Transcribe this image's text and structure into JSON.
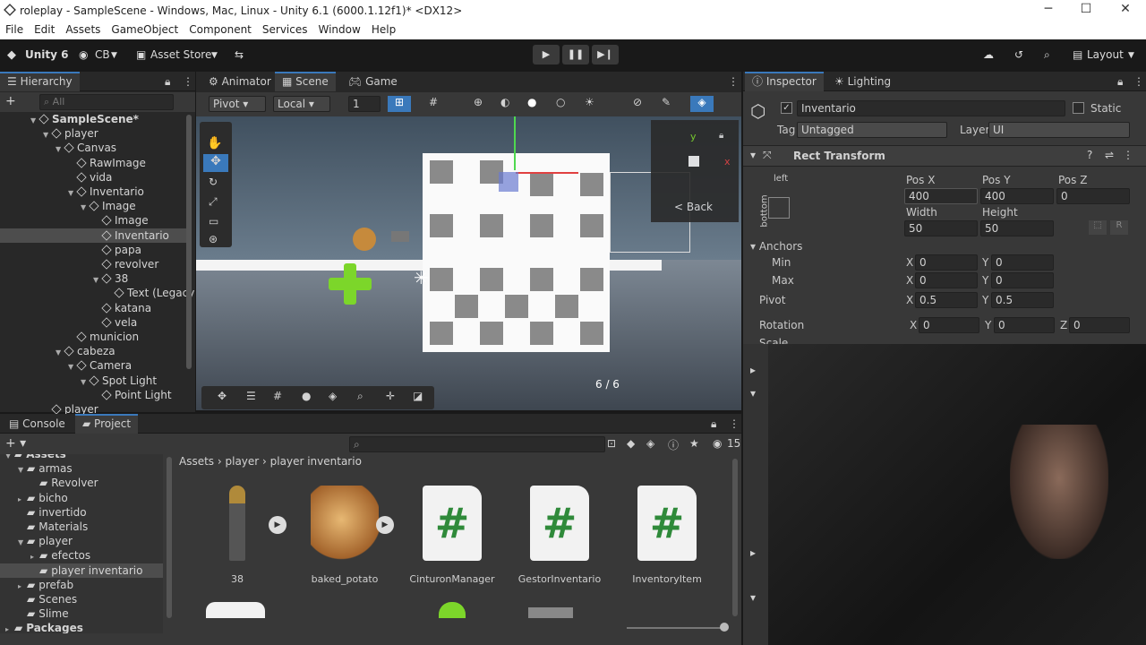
{
  "window": {
    "title": "roleplay - SampleScene - Windows, Mac, Linux - Unity 6.1 (6000.1.12f1)* <DX12>",
    "controls": [
      "─",
      "☐",
      "✕"
    ]
  },
  "menu": [
    "File",
    "Edit",
    "Assets",
    "GameObject",
    "Component",
    "Services",
    "Window",
    "Help"
  ],
  "toolbar": {
    "unity_label": "Unity 6",
    "account": "CB",
    "asset_store": "Asset Store",
    "layout": "Layout"
  },
  "hierarchy": {
    "tab": "Hierarchy",
    "search_placeholder": "All",
    "items": [
      {
        "label": "SampleScene*",
        "depth": 0,
        "bold": true
      },
      {
        "label": "player",
        "depth": 1
      },
      {
        "label": "Canvas",
        "depth": 2
      },
      {
        "label": "RawImage",
        "depth": 3
      },
      {
        "label": "vida",
        "depth": 3
      },
      {
        "label": "Inventario",
        "depth": 3
      },
      {
        "label": "Image",
        "depth": 4
      },
      {
        "label": "Image",
        "depth": 5
      },
      {
        "label": "Inventario",
        "depth": 5,
        "selected": true
      },
      {
        "label": "papa",
        "depth": 5
      },
      {
        "label": "revolver",
        "depth": 5
      },
      {
        "label": "38",
        "depth": 5
      },
      {
        "label": "Text (Legacy",
        "depth": 6
      },
      {
        "label": "katana",
        "depth": 5
      },
      {
        "label": "vela",
        "depth": 5
      },
      {
        "label": "municion",
        "depth": 3
      },
      {
        "label": "cabeza",
        "depth": 2
      },
      {
        "label": "Camera",
        "depth": 3
      },
      {
        "label": "Spot Light",
        "depth": 4
      },
      {
        "label": "Point Light",
        "depth": 5
      },
      {
        "label": "player",
        "depth": 1
      }
    ]
  },
  "scene_tabs": [
    "Animator",
    "Scene",
    "Game"
  ],
  "scene_toolbar": {
    "pivot": "Pivot",
    "local": "Local",
    "snap": "1"
  },
  "scene": {
    "back_label": "< Back",
    "counter": "6 / 6",
    "gizmo_y": "y",
    "gizmo_x": "x"
  },
  "inspector": {
    "tabs": [
      "Inspector",
      "Lighting"
    ],
    "object_name": "Inventario",
    "static_label": "Static",
    "tag_label": "Tag",
    "tag_value": "Untagged",
    "layer_label": "Layer",
    "layer_value": "UI",
    "component": "Rect Transform",
    "anchor_preset_top": "left",
    "anchor_preset_side": "bottom",
    "pos_labels": [
      "Pos X",
      "Pos Y",
      "Pos Z"
    ],
    "pos_values": [
      "400",
      "400",
      "0"
    ],
    "size_labels": [
      "Width",
      "Height"
    ],
    "size_values": [
      "50",
      "50"
    ],
    "r_button": "R",
    "anchors_label": "Anchors",
    "min_label": "Min",
    "min_values": [
      "0",
      "0"
    ],
    "max_label": "Max",
    "max_values": [
      "0",
      "0"
    ],
    "pivot_label": "Pivot",
    "pivot_values": [
      "0.5",
      "0.5"
    ],
    "rotation_label": "Rotation",
    "rotation_values": [
      "0",
      "0",
      "0"
    ],
    "scale_label": "Scale",
    "axis_x": "X",
    "axis_y": "Y",
    "axis_z": "Z"
  },
  "project": {
    "tabs": [
      "Console",
      "Project"
    ],
    "breadcrumb": [
      "Assets",
      "player",
      "player inventario"
    ],
    "count": "15",
    "folders": [
      {
        "label": "Assets",
        "depth": 0
      },
      {
        "label": "armas",
        "depth": 1
      },
      {
        "label": "Revolver",
        "depth": 2
      },
      {
        "label": "bicho",
        "depth": 1
      },
      {
        "label": "invertido",
        "depth": 1
      },
      {
        "label": "Materials",
        "depth": 1
      },
      {
        "label": "player",
        "depth": 1
      },
      {
        "label": "efectos",
        "depth": 2
      },
      {
        "label": "player inventario",
        "depth": 2,
        "selected": true
      },
      {
        "label": "prefab",
        "depth": 1
      },
      {
        "label": "Scenes",
        "depth": 1
      },
      {
        "label": "Slime",
        "depth": 1
      },
      {
        "label": "Packages",
        "depth": 0
      }
    ],
    "assets": [
      "38",
      "baked_potato",
      "CinturonManager",
      "GestorInventario",
      "InventoryItem"
    ],
    "hash_symbol": "#"
  },
  "colors": {
    "accent": "#3a79bb",
    "script_icon": "#2f8a3a"
  }
}
